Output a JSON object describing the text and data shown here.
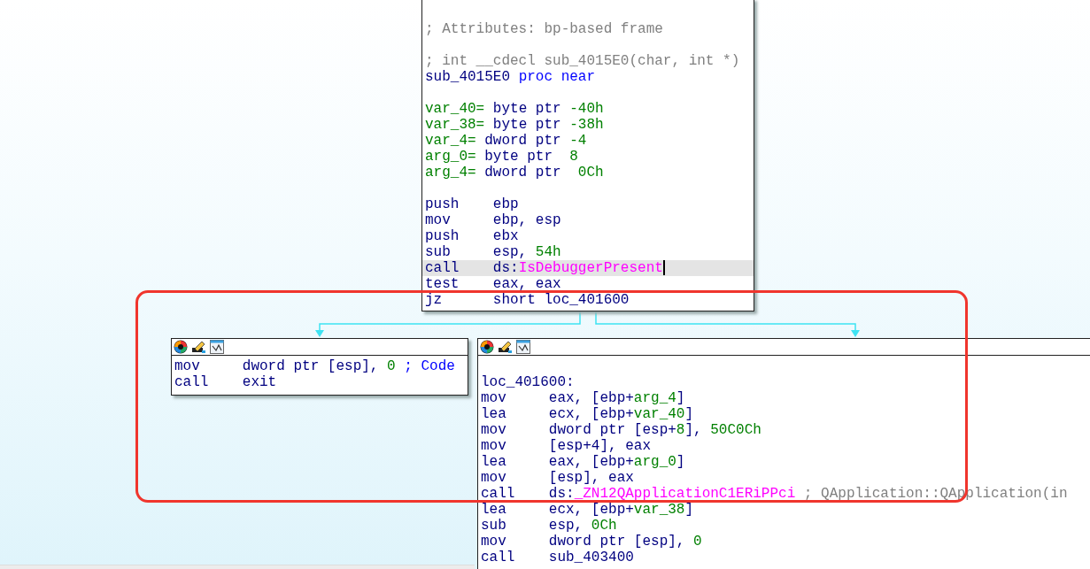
{
  "nodes": [
    {
      "kind": "function",
      "lines": [
        {
          "kind": "blank"
        },
        {
          "kind": "code",
          "selected": false,
          "tokens": [
            {
              "kind": "comment",
              "text": "; Attributes: bp-based frame"
            }
          ]
        },
        {
          "kind": "blank"
        },
        {
          "kind": "code",
          "selected": false,
          "tokens": [
            {
              "kind": "comment",
              "text": "; int __cdecl sub_4015E0(char, int *)"
            }
          ]
        },
        {
          "kind": "code",
          "selected": false,
          "tokens": [
            {
              "kind": "label",
              "text": "sub_4015E0 "
            },
            {
              "kind": "keyword",
              "text": "proc near"
            }
          ]
        },
        {
          "kind": "blank"
        },
        {
          "kind": "code",
          "selected": false,
          "tokens": [
            {
              "kind": "var",
              "text": "var_40="
            },
            {
              "kind": "operand",
              "text": " byte ptr "
            },
            {
              "kind": "number",
              "text": "-40h"
            }
          ]
        },
        {
          "kind": "code",
          "selected": false,
          "tokens": [
            {
              "kind": "var",
              "text": "var_38="
            },
            {
              "kind": "operand",
              "text": " byte ptr "
            },
            {
              "kind": "number",
              "text": "-38h"
            }
          ]
        },
        {
          "kind": "code",
          "selected": false,
          "tokens": [
            {
              "kind": "var",
              "text": "var_4="
            },
            {
              "kind": "operand",
              "text": " dword ptr "
            },
            {
              "kind": "number",
              "text": "-4"
            }
          ]
        },
        {
          "kind": "code",
          "selected": false,
          "tokens": [
            {
              "kind": "var",
              "text": "arg_0="
            },
            {
              "kind": "operand",
              "text": " byte ptr  "
            },
            {
              "kind": "number",
              "text": "8"
            }
          ]
        },
        {
          "kind": "code",
          "selected": false,
          "tokens": [
            {
              "kind": "var",
              "text": "arg_4="
            },
            {
              "kind": "operand",
              "text": " dword ptr  "
            },
            {
              "kind": "number",
              "text": "0Ch"
            }
          ]
        },
        {
          "kind": "blank"
        },
        {
          "kind": "code",
          "selected": false,
          "tokens": [
            {
              "kind": "mnemonic",
              "text": "push"
            },
            {
              "kind": "operand",
              "text": "ebp"
            }
          ]
        },
        {
          "kind": "code",
          "selected": false,
          "tokens": [
            {
              "kind": "mnemonic",
              "text": "mov"
            },
            {
              "kind": "operand",
              "text": "ebp, esp"
            }
          ]
        },
        {
          "kind": "code",
          "selected": false,
          "tokens": [
            {
              "kind": "mnemonic",
              "text": "push"
            },
            {
              "kind": "operand",
              "text": "ebx"
            }
          ]
        },
        {
          "kind": "code",
          "selected": false,
          "tokens": [
            {
              "kind": "mnemonic",
              "text": "sub"
            },
            {
              "kind": "operand",
              "text": "esp, "
            },
            {
              "kind": "number",
              "text": "54h"
            }
          ]
        },
        {
          "kind": "code",
          "selected": true,
          "tokens": [
            {
              "kind": "mnemonic",
              "text": "call"
            },
            {
              "kind": "operand",
              "text": "ds:"
            },
            {
              "kind": "import",
              "text": "IsDebuggerPresent"
            }
          ]
        },
        {
          "kind": "code",
          "selected": false,
          "tokens": [
            {
              "kind": "mnemonic",
              "text": "test"
            },
            {
              "kind": "operand",
              "text": "eax, eax"
            }
          ]
        },
        {
          "kind": "code",
          "selected": false,
          "tokens": [
            {
              "kind": "mnemonic",
              "text": "jz"
            },
            {
              "kind": "operand",
              "text": "short loc_401600"
            }
          ]
        }
      ]
    },
    {
      "kind": "block",
      "lines": [
        {
          "kind": "code",
          "selected": false,
          "tokens": [
            {
              "kind": "mnemonic",
              "text": "mov"
            },
            {
              "kind": "operand",
              "text": "dword ptr [esp], "
            },
            {
              "kind": "number",
              "text": "0"
            },
            {
              "kind": "ref",
              "text": " ; Code"
            }
          ]
        },
        {
          "kind": "code",
          "selected": false,
          "tokens": [
            {
              "kind": "mnemonic",
              "text": "call"
            },
            {
              "kind": "operand",
              "text": "exit"
            }
          ]
        }
      ]
    },
    {
      "kind": "block",
      "lines": [
        {
          "kind": "blank"
        },
        {
          "kind": "code",
          "selected": false,
          "tokens": [
            {
              "kind": "label",
              "text": "loc_401600:"
            }
          ]
        },
        {
          "kind": "code",
          "selected": false,
          "tokens": [
            {
              "kind": "mnemonic",
              "text": "mov"
            },
            {
              "kind": "operand",
              "text": "eax, [ebp+"
            },
            {
              "kind": "var",
              "text": "arg_4"
            },
            {
              "kind": "operand",
              "text": "]"
            }
          ]
        },
        {
          "kind": "code",
          "selected": false,
          "tokens": [
            {
              "kind": "mnemonic",
              "text": "lea"
            },
            {
              "kind": "operand",
              "text": "ecx, [ebp+"
            },
            {
              "kind": "var",
              "text": "var_40"
            },
            {
              "kind": "operand",
              "text": "]"
            }
          ]
        },
        {
          "kind": "code",
          "selected": false,
          "tokens": [
            {
              "kind": "mnemonic",
              "text": "mov"
            },
            {
              "kind": "operand",
              "text": "dword ptr [esp+"
            },
            {
              "kind": "number",
              "text": "8"
            },
            {
              "kind": "operand",
              "text": "], "
            },
            {
              "kind": "number",
              "text": "50C0Ch"
            }
          ]
        },
        {
          "kind": "code",
          "selected": false,
          "tokens": [
            {
              "kind": "mnemonic",
              "text": "mov"
            },
            {
              "kind": "operand",
              "text": "[esp+4], eax"
            }
          ]
        },
        {
          "kind": "code",
          "selected": false,
          "tokens": [
            {
              "kind": "mnemonic",
              "text": "lea"
            },
            {
              "kind": "operand",
              "text": "eax, [ebp+"
            },
            {
              "kind": "var",
              "text": "arg_0"
            },
            {
              "kind": "operand",
              "text": "]"
            }
          ]
        },
        {
          "kind": "code",
          "selected": false,
          "tokens": [
            {
              "kind": "mnemonic",
              "text": "mov"
            },
            {
              "kind": "operand",
              "text": "[esp], eax"
            }
          ]
        },
        {
          "kind": "code",
          "selected": false,
          "tokens": [
            {
              "kind": "mnemonic",
              "text": "call"
            },
            {
              "kind": "operand",
              "text": "ds:"
            },
            {
              "kind": "import",
              "text": "_ZN12QApplicationC1ERiPPci"
            },
            {
              "kind": "comment",
              "text": " ; QApplication::QApplication(in"
            }
          ]
        },
        {
          "kind": "code",
          "selected": false,
          "tokens": [
            {
              "kind": "mnemonic",
              "text": "lea"
            },
            {
              "kind": "operand",
              "text": "ecx, [ebp+"
            },
            {
              "kind": "var",
              "text": "var_38"
            },
            {
              "kind": "operand",
              "text": "]"
            }
          ]
        },
        {
          "kind": "code",
          "selected": false,
          "tokens": [
            {
              "kind": "mnemonic",
              "text": "sub"
            },
            {
              "kind": "operand",
              "text": "esp, "
            },
            {
              "kind": "number",
              "text": "0Ch"
            }
          ]
        },
        {
          "kind": "code",
          "selected": false,
          "tokens": [
            {
              "kind": "mnemonic",
              "text": "mov"
            },
            {
              "kind": "operand",
              "text": "dword ptr [esp], "
            },
            {
              "kind": "number",
              "text": "0"
            }
          ]
        },
        {
          "kind": "code",
          "selected": false,
          "tokens": [
            {
              "kind": "mnemonic",
              "text": "call"
            },
            {
              "kind": "operand",
              "text": "sub_403400"
            }
          ]
        }
      ]
    }
  ]
}
